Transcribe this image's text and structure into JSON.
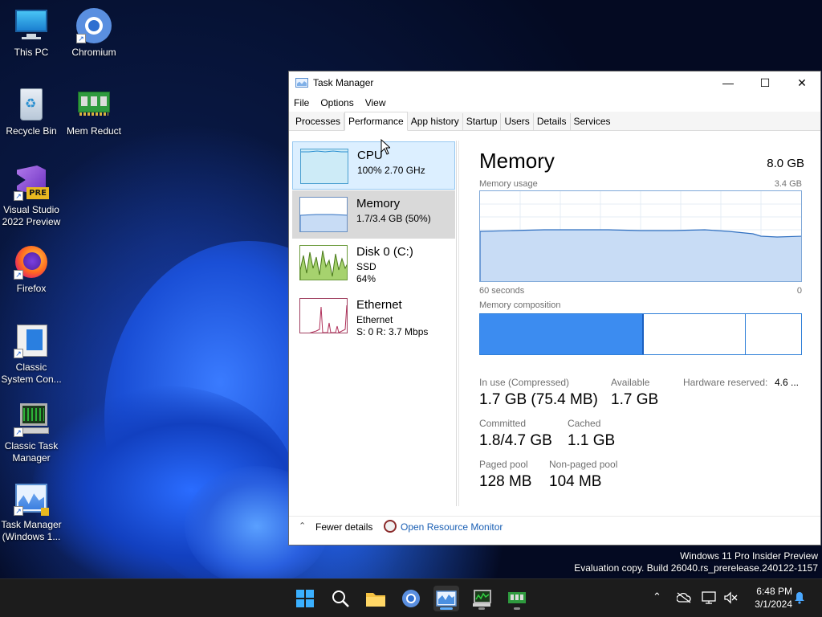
{
  "desktop": {
    "icons": [
      {
        "label": "This PC"
      },
      {
        "label": "Chromium"
      },
      {
        "label": "Recycle Bin"
      },
      {
        "label": "Mem Reduct"
      },
      {
        "label": "Visual Studio 2022 Preview",
        "badge": "PRE"
      },
      {
        "label": "Firefox"
      },
      {
        "label": "Classic System Con..."
      },
      {
        "label": "Classic Task Manager"
      },
      {
        "label": "Task Manager (Windows 1..."
      }
    ]
  },
  "window": {
    "title": "Task Manager",
    "menu": [
      "File",
      "Options",
      "View"
    ],
    "tabs": [
      "Processes",
      "Performance",
      "App history",
      "Startup",
      "Users",
      "Details",
      "Services"
    ],
    "active_tab": "Performance",
    "sidebar": [
      {
        "name": "CPU",
        "line1": "100%  2.70 GHz"
      },
      {
        "name": "Memory",
        "line1": "1.7/3.4 GB (50%)"
      },
      {
        "name": "Disk 0 (C:)",
        "line1": "SSD",
        "line2": "64%"
      },
      {
        "name": "Ethernet",
        "line1": "Ethernet",
        "line2": "S: 0  R: 3.7 Mbps"
      }
    ],
    "memory": {
      "title": "Memory",
      "total": "8.0 GB",
      "usage_label": "Memory usage",
      "usage_max": "3.4 GB",
      "axis_left": "60 seconds",
      "axis_right": "0",
      "composition_label": "Memory composition",
      "stats": {
        "in_use_label": "In use (Compressed)",
        "in_use_value": "1.7 GB (75.4 MB)",
        "available_label": "Available",
        "available_value": "1.7 GB",
        "hw_reserved_label": "Hardware reserved:",
        "hw_reserved_value": "4.6 ...",
        "committed_label": "Committed",
        "committed_value": "1.8/4.7 GB",
        "cached_label": "Cached",
        "cached_value": "1.1 GB",
        "paged_label": "Paged pool",
        "paged_value": "128 MB",
        "nonpaged_label": "Non-paged pool",
        "nonpaged_value": "104 MB"
      }
    },
    "footer": {
      "fewer_details": "Fewer details",
      "open_monitor": "Open Resource Monitor"
    }
  },
  "watermark": {
    "line1": "Windows 11 Pro Insider Preview",
    "line2": "Evaluation copy. Build 26040.rs_prerelease.240122-1157"
  },
  "taskbar": {
    "time": "6:48 PM",
    "date": "3/1/2024"
  },
  "colors": {
    "accent": "#3c8cf0",
    "memory_fill": "#c8dcf5",
    "memory_line": "#2f6fc0",
    "cpu_fill": "#cdebf7",
    "disk_fill": "#a6d26e",
    "ethernet_line": "#b0305a"
  }
}
